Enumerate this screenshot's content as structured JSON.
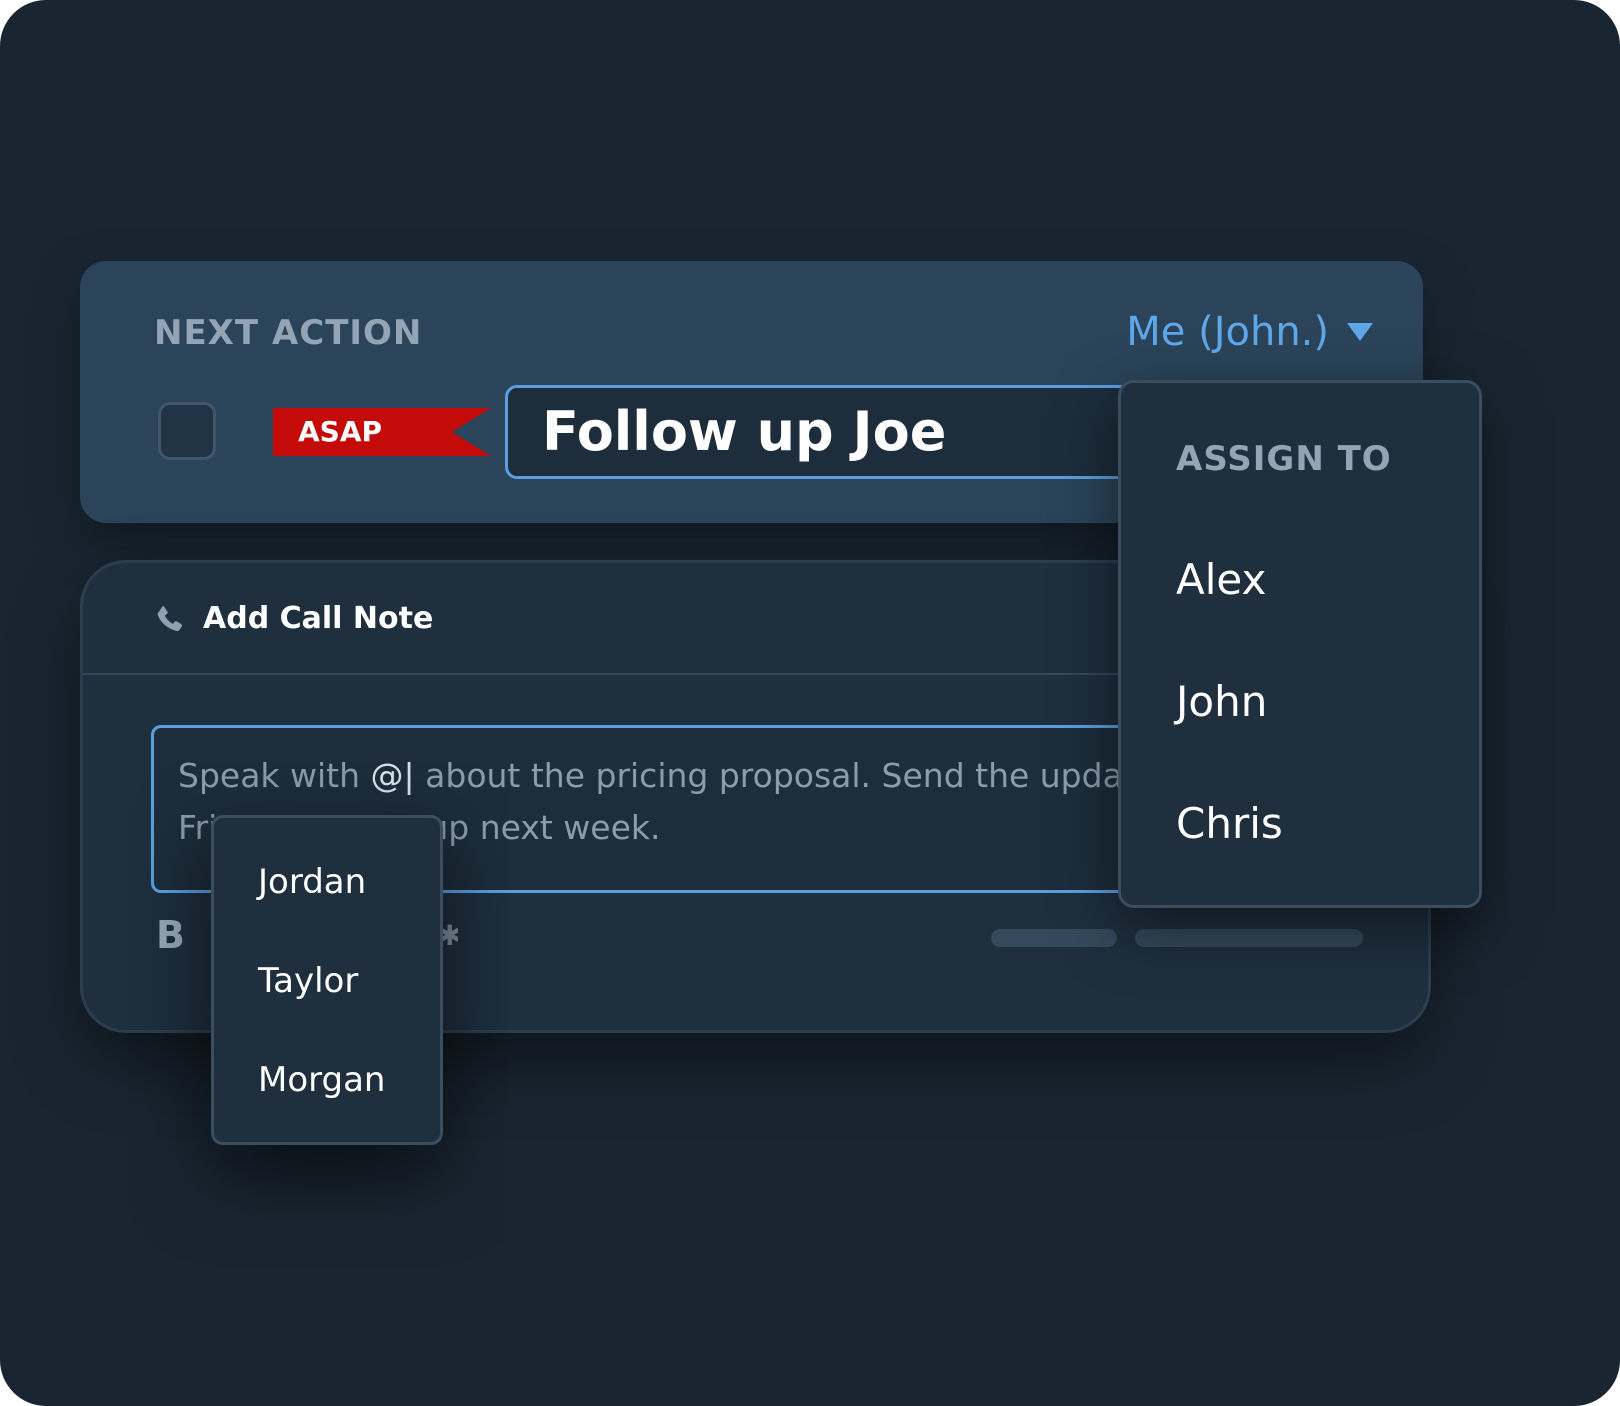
{
  "next_action": {
    "heading": "NEXT ACTION",
    "assignee_label": "Me (John.)",
    "priority_tag": "ASAP",
    "title_value": "Follow up Joe"
  },
  "call_note": {
    "title": "Add Call Note",
    "text_before_mention": "Speak with ",
    "mention_trigger": "@|",
    "text_after_mention": " about the pricing proposal. Send the updat",
    "text_line2_visible_start": "Fri",
    "text_line2_visible_end": "v up next week.",
    "bold_button_label": "B"
  },
  "assign_menu": {
    "heading": "ASSIGN TO",
    "options": [
      "Alex",
      "John",
      "Chris"
    ]
  },
  "mention_menu": {
    "options": [
      "Jordan",
      "Taylor",
      "Morgan"
    ]
  },
  "colors": {
    "background": "#192632",
    "card": "#2b4459",
    "accent": "#5ea7e9",
    "priority": "#c50a0a"
  }
}
